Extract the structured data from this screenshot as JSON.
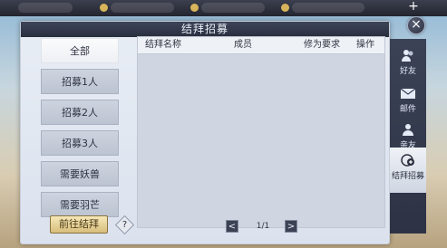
{
  "window": {
    "title": "结拜招募"
  },
  "categories": [
    {
      "label": "全部",
      "active": true
    },
    {
      "label": "招募1人",
      "active": false
    },
    {
      "label": "招募2人",
      "active": false
    },
    {
      "label": "招募3人",
      "active": false
    },
    {
      "label": "需要妖兽",
      "active": false
    },
    {
      "label": "需要羽芒",
      "active": false
    }
  ],
  "table": {
    "columns": [
      "结拜名称",
      "成员",
      "修为要求",
      "操作"
    ],
    "rows": []
  },
  "bottom": {
    "go_button": "前往结拜",
    "help": "?",
    "prev": "<",
    "page": "1/1",
    "next": ">"
  },
  "side_tabs": [
    {
      "label": "好友",
      "icon": "friends-icon",
      "active": false
    },
    {
      "label": "邮件",
      "icon": "mail-icon",
      "active": false
    },
    {
      "label": "亲友",
      "icon": "kin-icon",
      "active": false
    },
    {
      "label": "结拜招募",
      "icon": "sworn-recruit-icon",
      "active": true
    }
  ],
  "topbar": {
    "plus": "+"
  },
  "close": "×"
}
